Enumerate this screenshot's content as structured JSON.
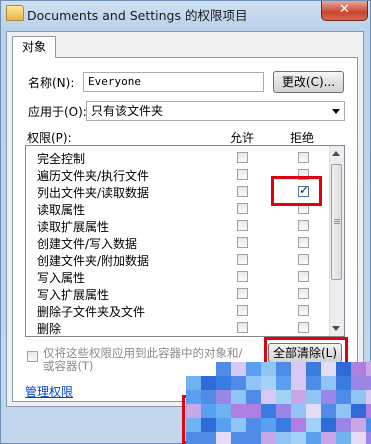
{
  "titlebar": {
    "title": "Documents and Settings 的权限项目",
    "close_glyph": "✕"
  },
  "tabs": [
    {
      "label": "对象"
    }
  ],
  "name_field": {
    "label": "名称(N):",
    "value": "Everyone",
    "change_button": "更改(C)..."
  },
  "apply_to": {
    "label": "应用于(O):",
    "selected": "只有该文件夹"
  },
  "permissions": {
    "header_label": "权限(P):",
    "allow_header": "允许",
    "deny_header": "拒绝",
    "rows": [
      {
        "name": "完全控制",
        "allow": false,
        "deny": false
      },
      {
        "name": "遍历文件夹/执行文件",
        "allow": false,
        "deny": false
      },
      {
        "name": "列出文件夹/读取数据",
        "allow": false,
        "deny": true
      },
      {
        "name": "读取属性",
        "allow": false,
        "deny": false
      },
      {
        "name": "读取扩展属性",
        "allow": false,
        "deny": false
      },
      {
        "name": "创建文件/写入数据",
        "allow": false,
        "deny": false
      },
      {
        "name": "创建文件夹/附加数据",
        "allow": false,
        "deny": false
      },
      {
        "name": "写入属性",
        "allow": false,
        "deny": false
      },
      {
        "name": "写入扩展属性",
        "allow": false,
        "deny": false
      },
      {
        "name": "删除子文件夹及文件",
        "allow": false,
        "deny": false
      },
      {
        "name": "删除",
        "allow": false,
        "deny": false
      }
    ]
  },
  "apply_only_checkbox": {
    "label": "仅将这些权限应用到此容器中的对象和/或容器(T)",
    "checked": false
  },
  "clear_all_button": "全部清除(L)",
  "manage_link": "管理权限",
  "colors": {
    "highlight_box": "#e00010",
    "link": "#0044cc"
  }
}
